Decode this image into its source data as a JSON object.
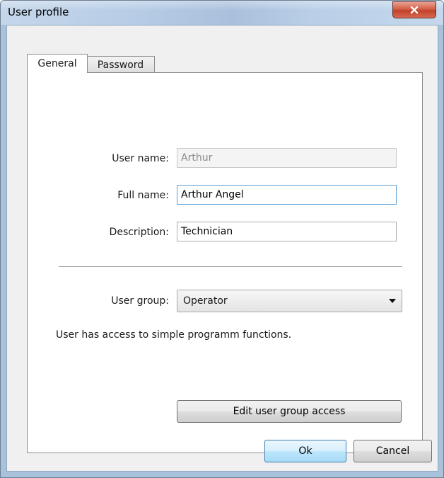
{
  "window": {
    "title": "User profile",
    "close_label": "x"
  },
  "tabs": [
    {
      "label": "General",
      "active": true
    },
    {
      "label": "Password",
      "active": false
    }
  ],
  "form": {
    "user_name": {
      "label": "User name:",
      "value": "Arthur",
      "disabled": true
    },
    "full_name": {
      "label": "Full name:",
      "value": "Arthur Angel"
    },
    "description": {
      "label": "Description:",
      "value": "Technician"
    },
    "user_group": {
      "label": "User group:",
      "selected": "Operator"
    },
    "group_description": "User has access to simple programm functions."
  },
  "buttons": {
    "edit_group_access": "Edit user group access",
    "ok": "Ok",
    "cancel": "Cancel"
  },
  "colors": {
    "accent_close": "#c2402a",
    "focus_border": "#5b9fd6"
  }
}
